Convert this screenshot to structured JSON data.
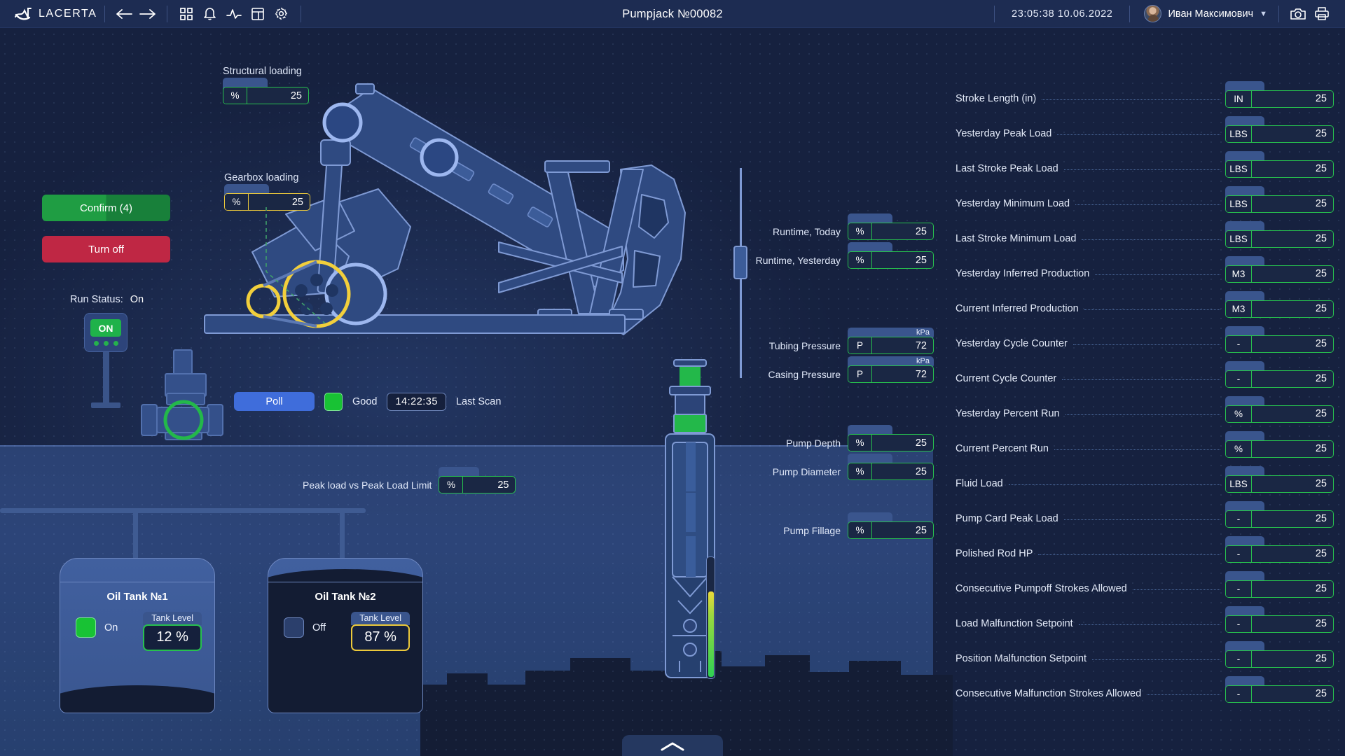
{
  "header": {
    "brand": "LACERTA",
    "nav_icons": [
      "back-arrow-icon",
      "forward-arrow-icon"
    ],
    "tool_icons": [
      "grid-icon",
      "bell-icon",
      "pulse-icon",
      "table-icon",
      "gear-icon"
    ],
    "title": "Pumpjack №00082",
    "clock": "23:05:38  10.06.2022",
    "user_name": "Иван Максимович",
    "right_icons": [
      "camera-icon",
      "print-icon"
    ]
  },
  "controls": {
    "confirm_label": "Confirm (4)",
    "turn_off_label": "Turn off",
    "run_status_label": "Run Status:",
    "run_status_value": "On",
    "on_panel_label": "ON"
  },
  "loading": {
    "structural_title": "Structural loading",
    "structural": {
      "unit": "%",
      "value": "25",
      "color": "green"
    },
    "gearbox_title": "Gearbox loading",
    "gearbox": {
      "unit": "%",
      "value": "25",
      "color": "yellow"
    }
  },
  "poll_bar": {
    "poll_label": "Poll",
    "quality": "Good",
    "scan_time": "14:22:35",
    "scan_label": "Last Scan"
  },
  "peak_load": {
    "label": "Peak load vs Peak Load Limit",
    "unit": "%",
    "value": "25"
  },
  "center_gauges": [
    {
      "label": "Runtime, Today",
      "unit": "%",
      "value": "25",
      "tab": ""
    },
    {
      "label": "Runtime, Yesterday",
      "unit": "%",
      "value": "25",
      "tab": ""
    },
    {
      "label": "Tubing Pressure",
      "unit": "P",
      "value": "72",
      "tab": "kPa"
    },
    {
      "label": "Casing Pressure",
      "unit": "P",
      "value": "72",
      "tab": "kPa"
    },
    {
      "label": "Pump Depth",
      "unit": "%",
      "value": "25",
      "tab": ""
    },
    {
      "label": "Pump Diameter",
      "unit": "%",
      "value": "25",
      "tab": ""
    },
    {
      "label": "Pump Fillage",
      "unit": "%",
      "value": "25",
      "tab": ""
    }
  ],
  "tanks": [
    {
      "title": "Oil Tank №1",
      "state": "On",
      "state_on": true,
      "level_label": "Tank Level",
      "level_value": "12 %",
      "level_pct": 12,
      "color": "green"
    },
    {
      "title": "Oil Tank №2",
      "state": "Off",
      "state_on": false,
      "level_label": "Tank Level",
      "level_value": "87 %",
      "level_pct": 87,
      "color": "yellow"
    }
  ],
  "parameters": [
    {
      "label": "Stroke Length (in)",
      "unit": "IN",
      "value": "25"
    },
    {
      "label": "Yesterday Peak Load",
      "unit": "LBS",
      "value": "25"
    },
    {
      "label": "Last Stroke Peak Load",
      "unit": "LBS",
      "value": "25"
    },
    {
      "label": "Yesterday Minimum Load",
      "unit": "LBS",
      "value": "25"
    },
    {
      "label": "Last Stroke Minimum Load",
      "unit": "LBS",
      "value": "25"
    },
    {
      "label": "Yesterday Inferred Production",
      "unit": "M3",
      "value": "25"
    },
    {
      "label": "Current Inferred Production",
      "unit": "M3",
      "value": "25"
    },
    {
      "label": "Yesterday Cycle Counter",
      "unit": "-",
      "value": "25"
    },
    {
      "label": "Current Cycle Counter",
      "unit": "-",
      "value": "25"
    },
    {
      "label": "Yesterday Percent Run",
      "unit": "%",
      "value": "25"
    },
    {
      "label": "Current Percent Run",
      "unit": "%",
      "value": "25"
    },
    {
      "label": "Fluid Load",
      "unit": "LBS",
      "value": "25"
    },
    {
      "label": "Pump Card Peak Load",
      "unit": "-",
      "value": "25"
    },
    {
      "label": "Polished Rod HP",
      "unit": "-",
      "value": "25"
    },
    {
      "label": "Consecutive Pumpoff Strokes Allowed",
      "unit": "-",
      "value": "25"
    },
    {
      "label": "Load Malfunction Setpoint",
      "unit": "-",
      "value": "25"
    },
    {
      "label": "Position Malfunction Setpoint",
      "unit": "-",
      "value": "25"
    },
    {
      "label": "Consecutive Malfunction Strokes Allowed",
      "unit": "-",
      "value": "25"
    }
  ],
  "colors": {
    "background": "#16213f",
    "header": "#1d2c52",
    "accent_green": "#27c14e",
    "accent_yellow": "#ecc93b",
    "accent_blue": "#3f6ddb",
    "danger_red": "#bf2744",
    "success_green": "#1f9d43",
    "machine_stroke": "#7f9ad4",
    "platform": "#2c4478"
  },
  "collapse_button": "chevron-up-icon"
}
